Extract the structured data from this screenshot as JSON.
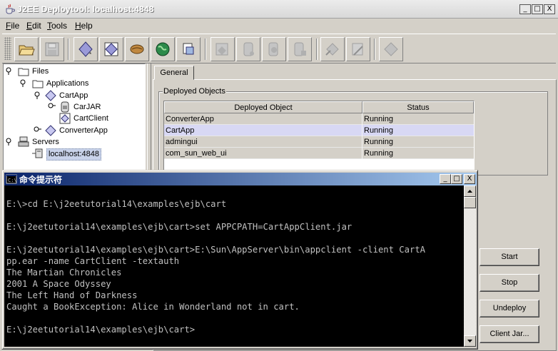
{
  "deploytool": {
    "title": "J2EE Deploytool: localhost:4848",
    "window_buttons": {
      "minimize": "_",
      "maximize": "□",
      "close": "X"
    },
    "menus": [
      {
        "label": "File",
        "mnemonic": "F",
        "rest": "ile"
      },
      {
        "label": "Edit",
        "mnemonic": "E",
        "rest": "dit"
      },
      {
        "label": "Tools",
        "mnemonic": "T",
        "rest": "ools"
      },
      {
        "label": "Help",
        "mnemonic": "H",
        "rest": "elp"
      }
    ],
    "toolbar_icons": [
      "open-folder-icon",
      "save-icon",
      "new-application-icon",
      "new-ejb-icon",
      "new-bean-icon",
      "new-web-component-icon",
      "new-client-icon",
      "deploy-icon",
      "undeploy-icon",
      "update-icon",
      "verify-icon",
      "tool-11-icon",
      "tool-12-icon",
      "tool-13-icon"
    ],
    "tree": {
      "files": "Files",
      "applications": "Applications",
      "cartapp": "CartApp",
      "carjar": "CarJAR",
      "cartclient": "CartClient",
      "converterapp": "ConverterApp",
      "servers": "Servers",
      "localhost": "localhost:4848"
    },
    "tab_general": "General",
    "deployed_objects_legend": "Deployed Objects",
    "table": {
      "headers": [
        "Deployed Object",
        "Status"
      ],
      "rows": [
        {
          "object": "ConverterApp",
          "status": "Running"
        },
        {
          "object": "CartApp",
          "status": "Running"
        },
        {
          "object": "admingui",
          "status": "Running"
        },
        {
          "object": "com_sun_web_ui",
          "status": "Running"
        }
      ]
    },
    "buttons": {
      "start": "Start",
      "stop": "Stop",
      "undeploy": "Undeploy",
      "client_jar": "Client Jar..."
    }
  },
  "cmd": {
    "title": "命令提示符",
    "window_buttons": {
      "minimize": "_",
      "maximize": "□",
      "close": "X"
    },
    "lines": [
      "",
      "E:\\>cd E:\\j2eetutorial14\\examples\\ejb\\cart",
      "",
      "E:\\j2eetutorial14\\examples\\ejb\\cart>set APPCPATH=CartAppClient.jar",
      "",
      "E:\\j2eetutorial14\\examples\\ejb\\cart>E:\\Sun\\AppServer\\bin\\appclient -client CartA",
      "pp.ear -name CartClient -textauth",
      "The Martian Chronicles",
      "2001 A Space Odyssey",
      "The Left Hand of Darkness",
      "Caught a BookException: Alice in Wonderland not in cart.",
      "",
      "E:\\j2eetutorial14\\examples\\ejb\\cart>"
    ]
  },
  "colors": {
    "window_bg": "#d4d0c8",
    "cmd_title_start": "#0a246a",
    "cmd_title_end": "#a6caf0",
    "console_bg": "#000000",
    "console_fg": "#c0c0c0",
    "selected_row": "#d8d8f4"
  }
}
